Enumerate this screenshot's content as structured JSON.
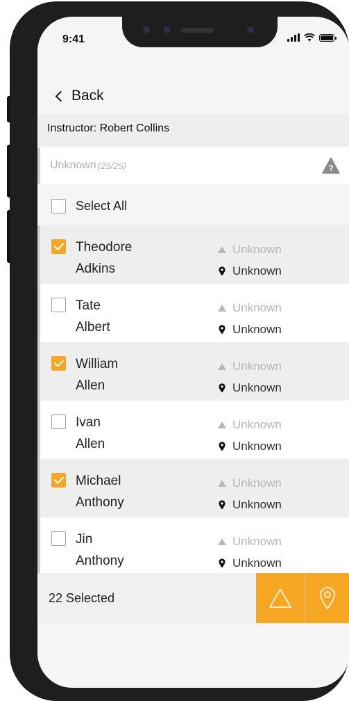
{
  "status_bar": {
    "time": "9:41"
  },
  "nav": {
    "back_label": "Back"
  },
  "instructor": {
    "label": "Instructor: Robert Collins"
  },
  "filter": {
    "label": "Unknown",
    "count": "(25/25)",
    "icon": "warning-question-icon"
  },
  "select_all": {
    "label": "Select All",
    "checked": false
  },
  "students": [
    {
      "first": "Theodore",
      "last": "Adkins",
      "status": "Unknown",
      "location": "Unknown",
      "checked": true
    },
    {
      "first": "Tate",
      "last": "Albert",
      "status": "Unknown",
      "location": "Unknown",
      "checked": false
    },
    {
      "first": "William",
      "last": "Allen",
      "status": "Unknown",
      "location": "Unknown",
      "checked": true
    },
    {
      "first": "Ivan",
      "last": "Allen",
      "status": "Unknown",
      "location": "Unknown",
      "checked": false
    },
    {
      "first": "Michael",
      "last": "Anthony",
      "status": "Unknown",
      "location": "Unknown",
      "checked": true
    },
    {
      "first": "Jin",
      "last": "Anthony",
      "status": "Unknown",
      "location": "Unknown",
      "checked": false
    }
  ],
  "footer": {
    "selected_label": "22 Selected",
    "warning_button_icon": "warning-triangle-icon",
    "location_button_icon": "location-pin-icon"
  },
  "colors": {
    "accent": "#f5a623",
    "muted_text": "#b8b8b8",
    "row_shaded": "#eeeeee"
  }
}
